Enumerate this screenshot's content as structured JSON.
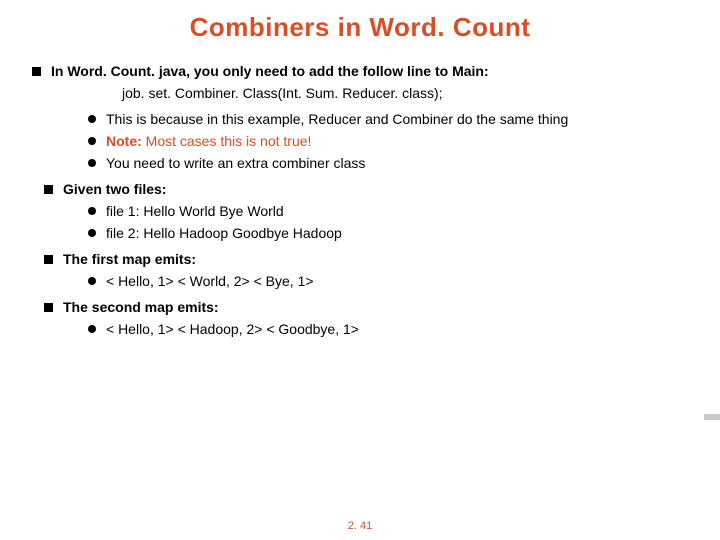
{
  "title": "Combiners in Word. Count",
  "l1": "In Word. Count. java, you only need to add the follow line to Main:",
  "code": "job. set. Combiner. Class(Int. Sum. Reducer. class);",
  "sub1": "This is because in this example, Reducer and Combiner do the same thing",
  "sub2a": "Note:",
  "sub2b": " Most cases this is not true!",
  "sub3": "You need to write an extra combiner class",
  "l2": "Given two files:",
  "f1": "file 1: Hello World Bye World",
  "f2": "file 2: Hello Hadoop Goodbye Hadoop",
  "l3": "The first map emits:",
  "m1": "< Hello, 1> < World, 2> < Bye, 1>",
  "l4": "The second map emits:",
  "m2": "< Hello, 1> < Hadoop, 2> < Goodbye, 1>",
  "page": "2. 41"
}
